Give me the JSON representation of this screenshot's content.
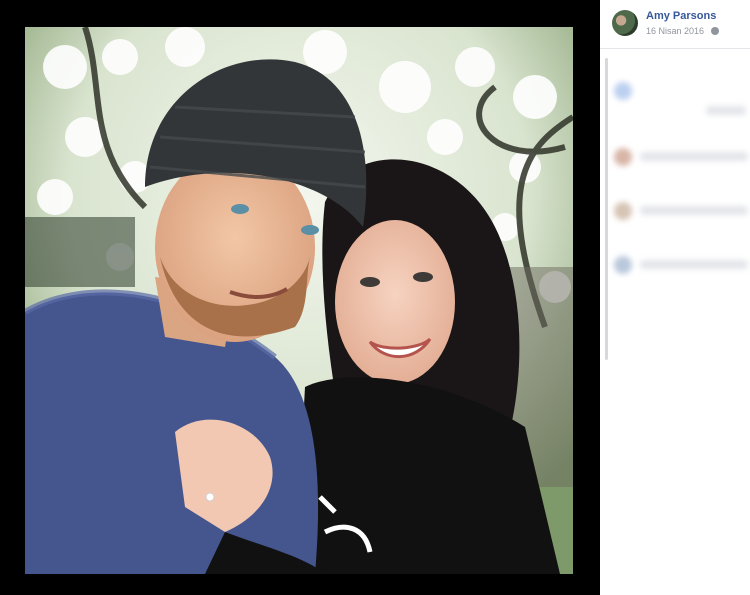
{
  "post": {
    "author_name": "Amy Parsons",
    "date": "16 Nisan 2016"
  },
  "photo": {
    "subject": "couple selfie under blossoming tree"
  },
  "colors": {
    "author_link": "#365899",
    "meta_text": "#90949c",
    "viewer_bg": "#000000"
  },
  "icons": {
    "privacy": "globe-icon"
  }
}
